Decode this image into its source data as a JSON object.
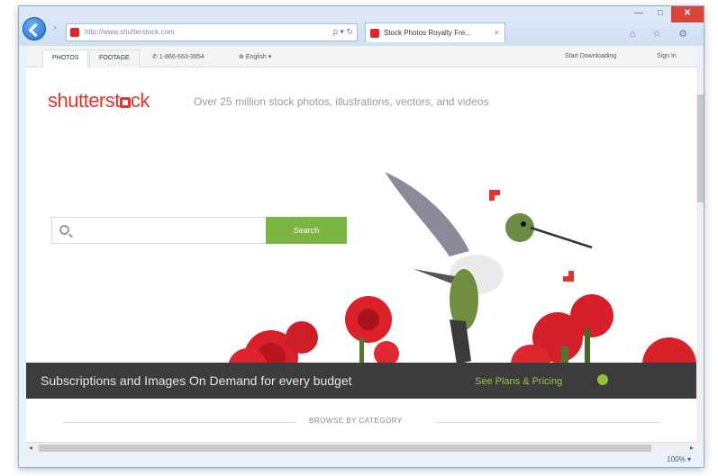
{
  "browser": {
    "url": "http://www.shutterstock.com",
    "tab_title": "Stock Photos Royalty Fre...",
    "tab_close": "×",
    "address_tools": "ρ ▾ ↻",
    "forward": "›",
    "window_controls": {
      "minimize": "—",
      "maximize": "□",
      "close": "✕"
    },
    "toolbar_icons": "⌂ ☆ ⚙",
    "zoom": "100% ▾"
  },
  "site_nav": {
    "tabs": [
      "PHOTOS",
      "FOOTAGE"
    ],
    "phone": "1-866-663-3954",
    "language": "English ▾",
    "right_links": [
      "Start Downloading",
      "Sign In"
    ]
  },
  "hero": {
    "logo": {
      "before": "shutterst",
      "after": "ck"
    },
    "tagline": "Over 25 million stock photos, illustrations, vectors, and videos",
    "search_placeholder": "",
    "search_button": "Search"
  },
  "banner": {
    "text": "Subscriptions and Images On Demand for every budget",
    "link": "See Plans & Pricing"
  },
  "category": {
    "label": "BROWSE BY CATEGORY"
  },
  "colors": {
    "brand_red": "#e8322b",
    "search_green": "#7ab441",
    "banner_bg": "#3c3c3e",
    "pricing_green": "#9bc34b"
  },
  "icons": [
    "back-arrow-icon",
    "favicon-icon",
    "search-icon",
    "home-icon",
    "star-icon",
    "gear-icon"
  ]
}
